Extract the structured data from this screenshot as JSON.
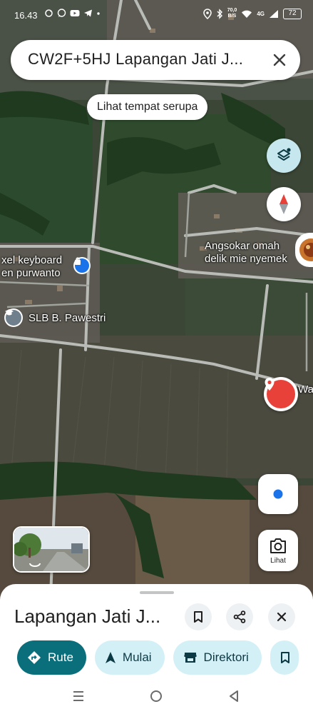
{
  "status_bar": {
    "time": "16.43",
    "speed_value": "70,0",
    "speed_unit": "B/S",
    "network": "4G",
    "battery": "72"
  },
  "search": {
    "query": "CW2F+5HJ Lapangan Jati J..."
  },
  "suggestion_chip": "Lihat tempat serupa",
  "map_labels": {
    "shop_line1": "xel keyboard",
    "shop_line2": "en purwanto",
    "school": "SLB B. Pawestri",
    "food_line1": "Angsokar omah",
    "food_line2": "delik mie nyemek",
    "pin_label": "War"
  },
  "controls": {
    "lens_label": "Lihat"
  },
  "sheet": {
    "title": "Lapangan Jati J...",
    "actions": {
      "route": "Rute",
      "start": "Mulai",
      "directory": "Direktori"
    }
  },
  "colors": {
    "accent": "#0b6e7b",
    "chip_bg": "#d4f0f7",
    "pin_red": "#e8413a",
    "poi_blue": "#1a73e8",
    "layers_bg": "#c7e7ee"
  }
}
